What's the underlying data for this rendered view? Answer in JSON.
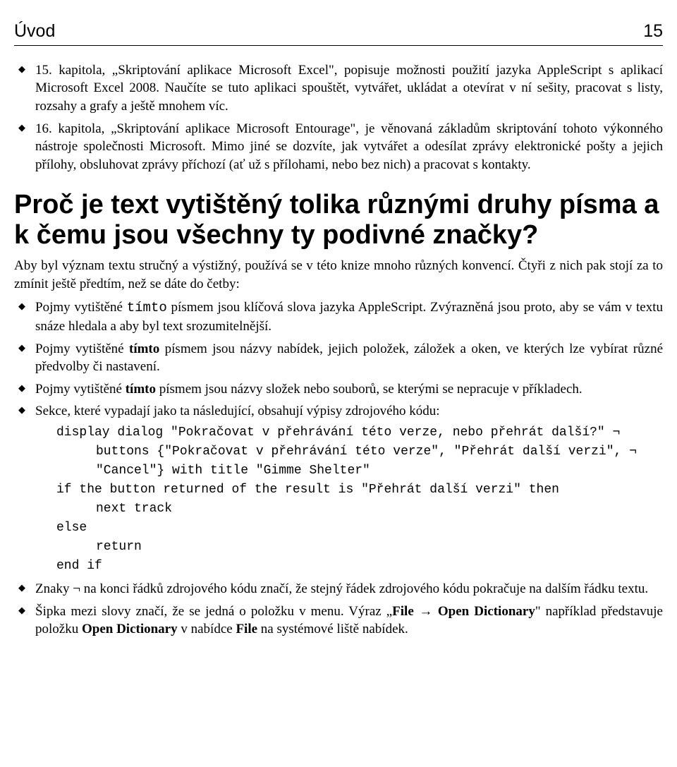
{
  "header": {
    "title": "Úvod",
    "page": "15"
  },
  "list1": [
    "15. kapitola, „Skriptování aplikace Microsoft Excel\", popisuje možnosti použití jazyka AppleScript s aplikací Microsoft Excel 2008. Naučíte se tuto aplikaci spouštět, vytvářet, ukládat a otevírat v ní sešity, pracovat s listy, rozsahy a grafy a ještě mnohem víc.",
    "16. kapitola, „Skriptování aplikace Microsoft Entourage\", je věnovaná základům skriptování tohoto výkonného nástroje společnosti Microsoft. Mimo jiné se dozvíte, jak vytvářet a odesílat zprávy elektronické pošty a jejich přílohy, obsluhovat zprávy příchozí (ať už s přílohami, nebo bez nich) a pracovat s kontakty."
  ],
  "heading": "Proč je text vytištěný tolika různými druhy písma a k čemu jsou všechny ty podivné značky?",
  "para1": "Aby byl význam textu stručný a výstižný, používá se v této knize mnoho různých konvencí. Čtyři z nich pak stojí za to zmínit ještě předtím, než se dáte do četby:",
  "list2": {
    "i0a": "Pojmy vytištěné ",
    "i0mono": "tímto",
    "i0b": " písmem jsou klíčová slova jazyka AppleScript. Zvýrazněná jsou proto, aby se vám v textu snáze hledala a aby byl text srozumitelnější.",
    "i1a": "Pojmy vytištěné ",
    "i1bold": "tímto",
    "i1b": " písmem jsou názvy nabídek, jejich položek, záložek a oken, ve kterých lze vybírat různé předvolby či nastavení.",
    "i2a": "Pojmy vytištěné ",
    "i2bold": "tímto",
    "i2b": " písmem jsou názvy složek nebo souborů, se kterými se nepracuje v příkladech.",
    "i3": "Sekce, které vypadají jako ta následující, obsahují výpisy zdrojového kódu:"
  },
  "code": {
    "l1": "display dialog \"Pokračovat v přehrávání této verze, nebo přehrát další?\" ¬",
    "l2": "buttons {\"Pokračovat v přehrávání této verze\", \"Přehrát další verzi\", ¬",
    "l3": "\"Cancel\"} with title \"Gimme Shelter\"",
    "l4": "if the button returned of the result is \"Přehrát další verzi\" then",
    "l5": "next track",
    "l6": "else",
    "l7": "return",
    "l8": "end if"
  },
  "list3": {
    "i0": "Znaky ¬ na konci řádků zdrojového kódu značí, že stejný řádek zdrojového kódu pokračuje na dalším řádku textu.",
    "i1a": "Šipka mezi slovy značí, že se jedná o položku v menu. Výraz „",
    "i1b1": "File",
    "i1arrow": " → ",
    "i1b2": "Open Dictionary",
    "i1c": "\" například představuje položku ",
    "i1b3": "Open Dictionary",
    "i1d": " v nabídce ",
    "i1b4": "File",
    "i1e": " na systémové liště nabídek."
  }
}
